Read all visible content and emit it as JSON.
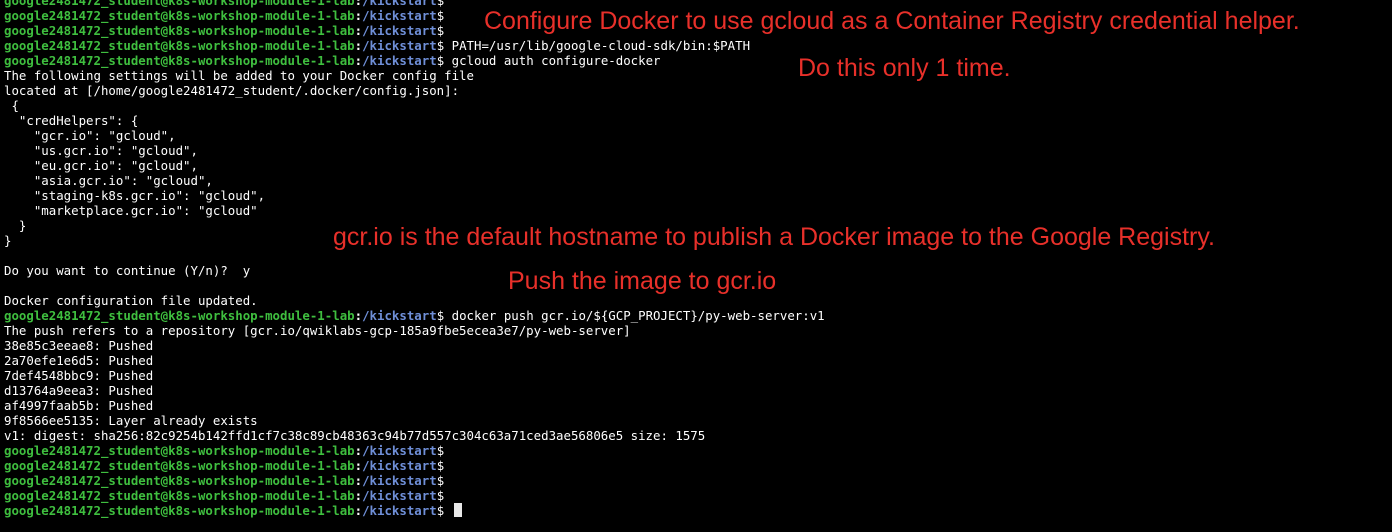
{
  "prompt": {
    "user_host": "google2481472_student@k8s-workshop-module-1-lab",
    "separator": ":",
    "path": "/kickstart",
    "dollar": "$"
  },
  "terminal": {
    "lines": [
      {
        "kind": "prompt",
        "command": ""
      },
      {
        "kind": "prompt",
        "command": ""
      },
      {
        "kind": "prompt",
        "command": ""
      },
      {
        "kind": "prompt",
        "command": " PATH=/usr/lib/google-cloud-sdk/bin:$PATH"
      },
      {
        "kind": "prompt",
        "command": " gcloud auth configure-docker"
      },
      {
        "kind": "output",
        "text": "The following settings will be added to your Docker config file"
      },
      {
        "kind": "output",
        "text": "located at [/home/google2481472_student/.docker/config.json]:"
      },
      {
        "kind": "output",
        "text": " {"
      },
      {
        "kind": "output",
        "text": "  \"credHelpers\": {"
      },
      {
        "kind": "output",
        "text": "    \"gcr.io\": \"gcloud\","
      },
      {
        "kind": "output",
        "text": "    \"us.gcr.io\": \"gcloud\","
      },
      {
        "kind": "output",
        "text": "    \"eu.gcr.io\": \"gcloud\","
      },
      {
        "kind": "output",
        "text": "    \"asia.gcr.io\": \"gcloud\","
      },
      {
        "kind": "output",
        "text": "    \"staging-k8s.gcr.io\": \"gcloud\","
      },
      {
        "kind": "output",
        "text": "    \"marketplace.gcr.io\": \"gcloud\""
      },
      {
        "kind": "output",
        "text": "  }"
      },
      {
        "kind": "output",
        "text": "}"
      },
      {
        "kind": "output",
        "text": ""
      },
      {
        "kind": "output",
        "text": "Do you want to continue (Y/n)?  y"
      },
      {
        "kind": "output",
        "text": ""
      },
      {
        "kind": "output",
        "text": "Docker configuration file updated."
      },
      {
        "kind": "prompt",
        "command": " docker push gcr.io/${GCP_PROJECT}/py-web-server:v1"
      },
      {
        "kind": "output",
        "text": "The push refers to a repository [gcr.io/qwiklabs-gcp-185a9fbe5ecea3e7/py-web-server]"
      },
      {
        "kind": "output",
        "text": "38e85c3eeae8: Pushed"
      },
      {
        "kind": "output",
        "text": "2a70efe1e6d5: Pushed"
      },
      {
        "kind": "output",
        "text": "7def4548bbc9: Pushed"
      },
      {
        "kind": "output",
        "text": "d13764a9eea3: Pushed"
      },
      {
        "kind": "output",
        "text": "af4997faab5b: Pushed"
      },
      {
        "kind": "output",
        "text": "9f8566ee5135: Layer already exists"
      },
      {
        "kind": "output",
        "text": "v1: digest: sha256:82c9254b142ffd1cf7c38c89cb48363c94b77d557c304c63a71ced3ae56806e5 size: 1575"
      },
      {
        "kind": "prompt",
        "command": ""
      },
      {
        "kind": "prompt",
        "command": ""
      },
      {
        "kind": "prompt",
        "command": ""
      },
      {
        "kind": "prompt",
        "command": ""
      },
      {
        "kind": "prompt",
        "command": " ",
        "cursor": true
      }
    ]
  },
  "annotations": {
    "configure_helper": "Configure Docker to use gcloud as a Container Registry credential helper.",
    "only_once": "Do this only 1 time.",
    "gcr_default": "gcr.io is the default hostname to publish a Docker image to the Google Registry.",
    "push_image": "Push the image to gcr.io"
  },
  "colors": {
    "background": "#000000",
    "prompt_user": "#3fbf3f",
    "prompt_path": "#6f8fd8",
    "annotation": "#e8302a"
  }
}
